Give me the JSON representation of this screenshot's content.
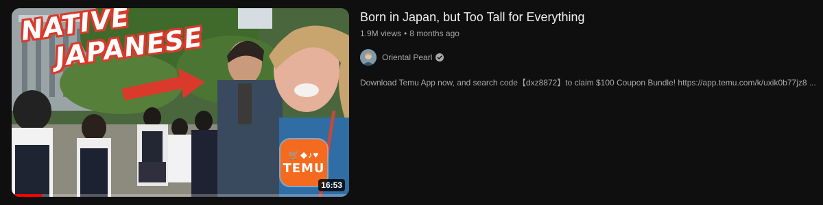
{
  "video": {
    "title": "Born in Japan, but Too Tall for Everything",
    "views": "1.9M views",
    "separator": "•",
    "age": "8 months ago",
    "duration": "16:53",
    "watch_progress_fraction": 0.09,
    "thumbnail": {
      "overlay_line_1": "NATIVE",
      "overlay_line_2": "JAPANESE",
      "sponsor_glyphs": "🛒◆♪♥",
      "sponsor_brand": "TEMU"
    }
  },
  "channel": {
    "name": "Oriental Pearl",
    "verified": true
  },
  "description": "Download Temu App now, and search code【dxz8872】to claim $100 Coupon Bundle! https://app.temu.com/k/uxik0b77jz8 ...",
  "colors": {
    "background": "#0f0f0f",
    "title": "#f1f1f1",
    "secondary_text": "#aaaaaa",
    "progress": "#ff0000",
    "temu_orange": "#f46b1f",
    "overlay_outline": "#d93a2b"
  }
}
